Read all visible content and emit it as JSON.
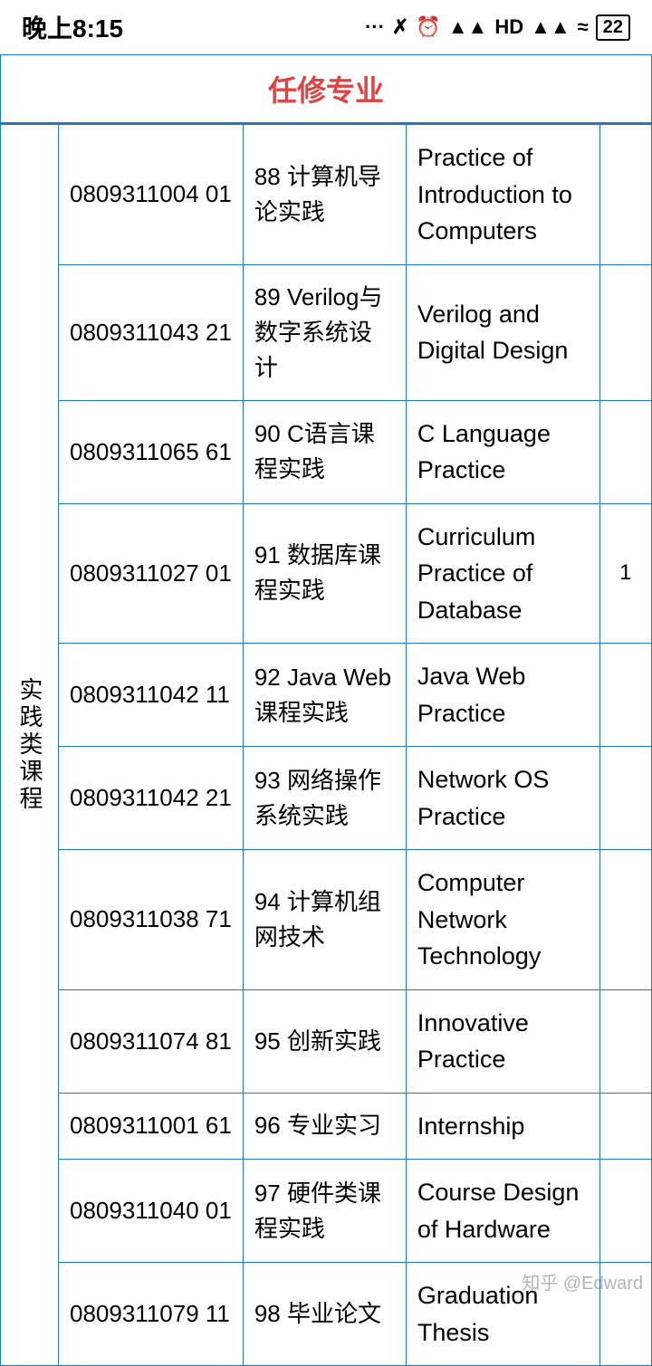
{
  "statusBar": {
    "time": "晚上8:15",
    "icons": "... ᛒ ⏰ ▲▲ HD▲▲ ◀ 22"
  },
  "sectionHeader": "任修专业",
  "category": "实践类课程",
  "rows": [
    {
      "code": "0809311004 01",
      "zh": "88 计算机导论实践",
      "en": "Practice of Introduction to Computers",
      "extra": ""
    },
    {
      "code": "0809311043 21",
      "zh": "89 Verilog与数字系统设计",
      "en": "Verilog and Digital Design",
      "extra": ""
    },
    {
      "code": "0809311065 61",
      "zh": "90 C语言课程实践",
      "en": "C Language Practice",
      "extra": ""
    },
    {
      "code": "0809311027 01",
      "zh": "91 数据库课程实践",
      "en": "Curriculum Practice of Database",
      "extra": "1"
    },
    {
      "code": "0809311042 11",
      "zh": "92 Java Web课程实践",
      "en": "Java Web Practice",
      "extra": ""
    },
    {
      "code": "0809311042 21",
      "zh": "93 网络操作系统实践",
      "en": "Network OS Practice",
      "extra": ""
    },
    {
      "code": "0809311038 71",
      "zh": "94 计算机组网技术",
      "en": "Computer Network Technology",
      "extra": ""
    },
    {
      "code": "0809311074 81",
      "zh": "95 创新实践",
      "en": "Innovative Practice",
      "extra": ""
    },
    {
      "code": "0809311001 61",
      "zh": "96 专业实习",
      "en": "Internship",
      "extra": ""
    },
    {
      "code": "0809311040 01",
      "zh": "97 硬件类课程实践",
      "en": "Course Design of Hardware",
      "extra": ""
    },
    {
      "code": "0809311079 11",
      "zh": "98 毕业论文",
      "en": "Graduation Thesis",
      "extra": ""
    }
  ],
  "watermark": "知乎 @Edward"
}
